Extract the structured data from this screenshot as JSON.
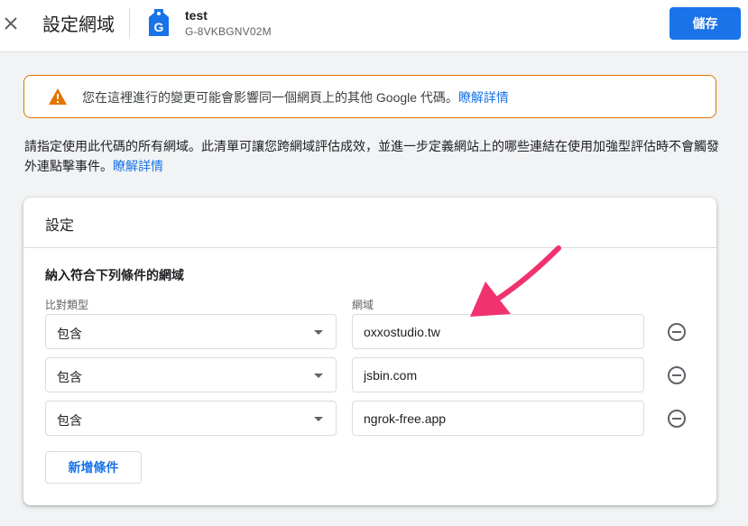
{
  "header": {
    "title": "設定網域",
    "stream_name": "test",
    "stream_id": "G-8VKBGNV02M",
    "tag_letter": "G",
    "save_label": "儲存"
  },
  "warning": {
    "text": "您在這裡進行的變更可能會影響同一個網頁上的其他 Google 代碼。",
    "link": "瞭解詳情"
  },
  "description": {
    "text": "請指定使用此代碼的所有網域。此清單可讓您跨網域評估成效，並進一步定義網站上的哪些連結在使用加強型評估時不會觸發外連點擊事件。",
    "link": "瞭解詳情"
  },
  "card": {
    "title": "設定",
    "section_title": "納入符合下列條件的網域",
    "match_type_label": "比對類型",
    "domain_label": "網域",
    "rows": [
      {
        "match_type": "包含",
        "domain": "oxxostudio.tw"
      },
      {
        "match_type": "包含",
        "domain": "jsbin.com"
      },
      {
        "match_type": "包含",
        "domain": "ngrok-free.app"
      }
    ],
    "add_label": "新增條件"
  },
  "colors": {
    "accent": "#1a73e8",
    "warning": "#e37400",
    "annotation_arrow": "#f0326e"
  },
  "icons": {
    "close": "close-icon",
    "tag": "google-tag-icon",
    "warning": "warning-icon",
    "remove": "remove-circle-icon",
    "dropdown": "chevron-down-icon"
  }
}
